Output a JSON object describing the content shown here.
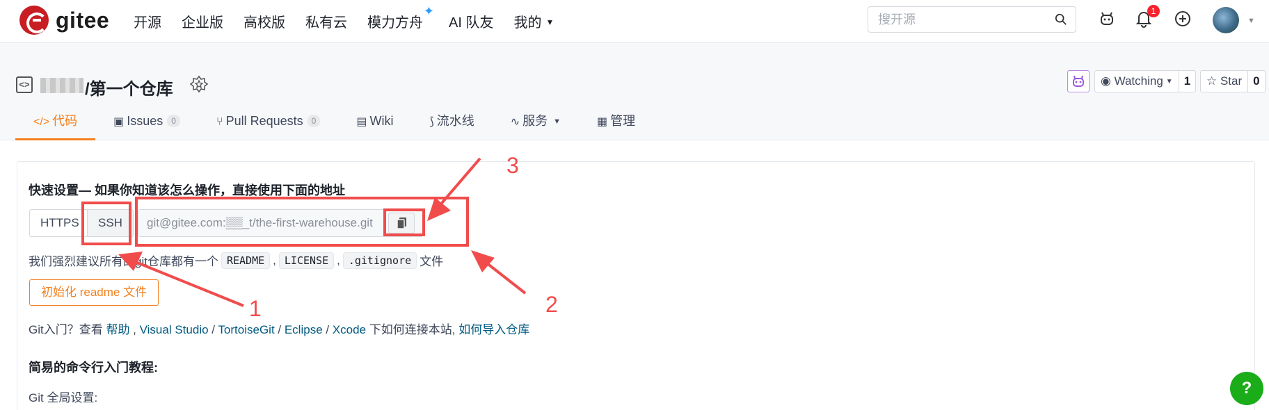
{
  "topnav": {
    "logo_text": "gitee",
    "links": [
      "开源",
      "企业版",
      "高校版",
      "私有云",
      "模力方舟",
      "AI 队友",
      "我的"
    ],
    "search_placeholder": "搜开源",
    "notification_count": "1"
  },
  "repo": {
    "title": "/第一个仓库",
    "watching_label": "Watching",
    "watching_count": "1",
    "star_label": "Star",
    "star_count": "0"
  },
  "tabs": [
    {
      "label": "代码",
      "icon": "code-icon"
    },
    {
      "label": "Issues",
      "count": "0",
      "icon": "issues-icon"
    },
    {
      "label": "Pull Requests",
      "count": "0",
      "icon": "pull-request-icon"
    },
    {
      "label": "Wiki",
      "icon": "wiki-icon"
    },
    {
      "label": "流水线",
      "icon": "pipeline-icon"
    },
    {
      "label": "服务",
      "icon": "service-icon"
    },
    {
      "label": "管理",
      "icon": "manage-icon"
    }
  ],
  "quick_setup": {
    "title": "快速设置— 如果你知道该怎么操作，直接使用下面的地址",
    "https_label": "HTTPS",
    "ssh_label": "SSH",
    "url_value": "git@gitee.com:▒▒_t/the-first-warehouse.git",
    "suggest_prefix": "我们强烈建议所有的git仓库都有一个",
    "readme": "README",
    "license": "LICENSE",
    "gitignore": ".gitignore",
    "suggest_suffix": "文件",
    "sep": ",",
    "init_button": "初始化 readme 文件",
    "git_intro_prefix": "Git入门？查看 ",
    "help_link": "帮助",
    "vs_link": "Visual Studio",
    "tortoise_link": "TortoiseGit",
    "eclipse_link": "Eclipse",
    "xcode_link": "Xcode",
    "git_intro_mid": " 下如何连接本站, ",
    "import_link": "如何导入仓库",
    "cmd_title": "简易的命令行入门教程:",
    "git_global": "Git 全局设置:"
  },
  "help_button": "?",
  "annotations": {
    "n1": "1",
    "n2": "2",
    "n3": "3"
  },
  "colors": {
    "accent": "#f4801e",
    "annotation": "#f14c4c",
    "link": "#005980",
    "help": "#1aad19"
  }
}
